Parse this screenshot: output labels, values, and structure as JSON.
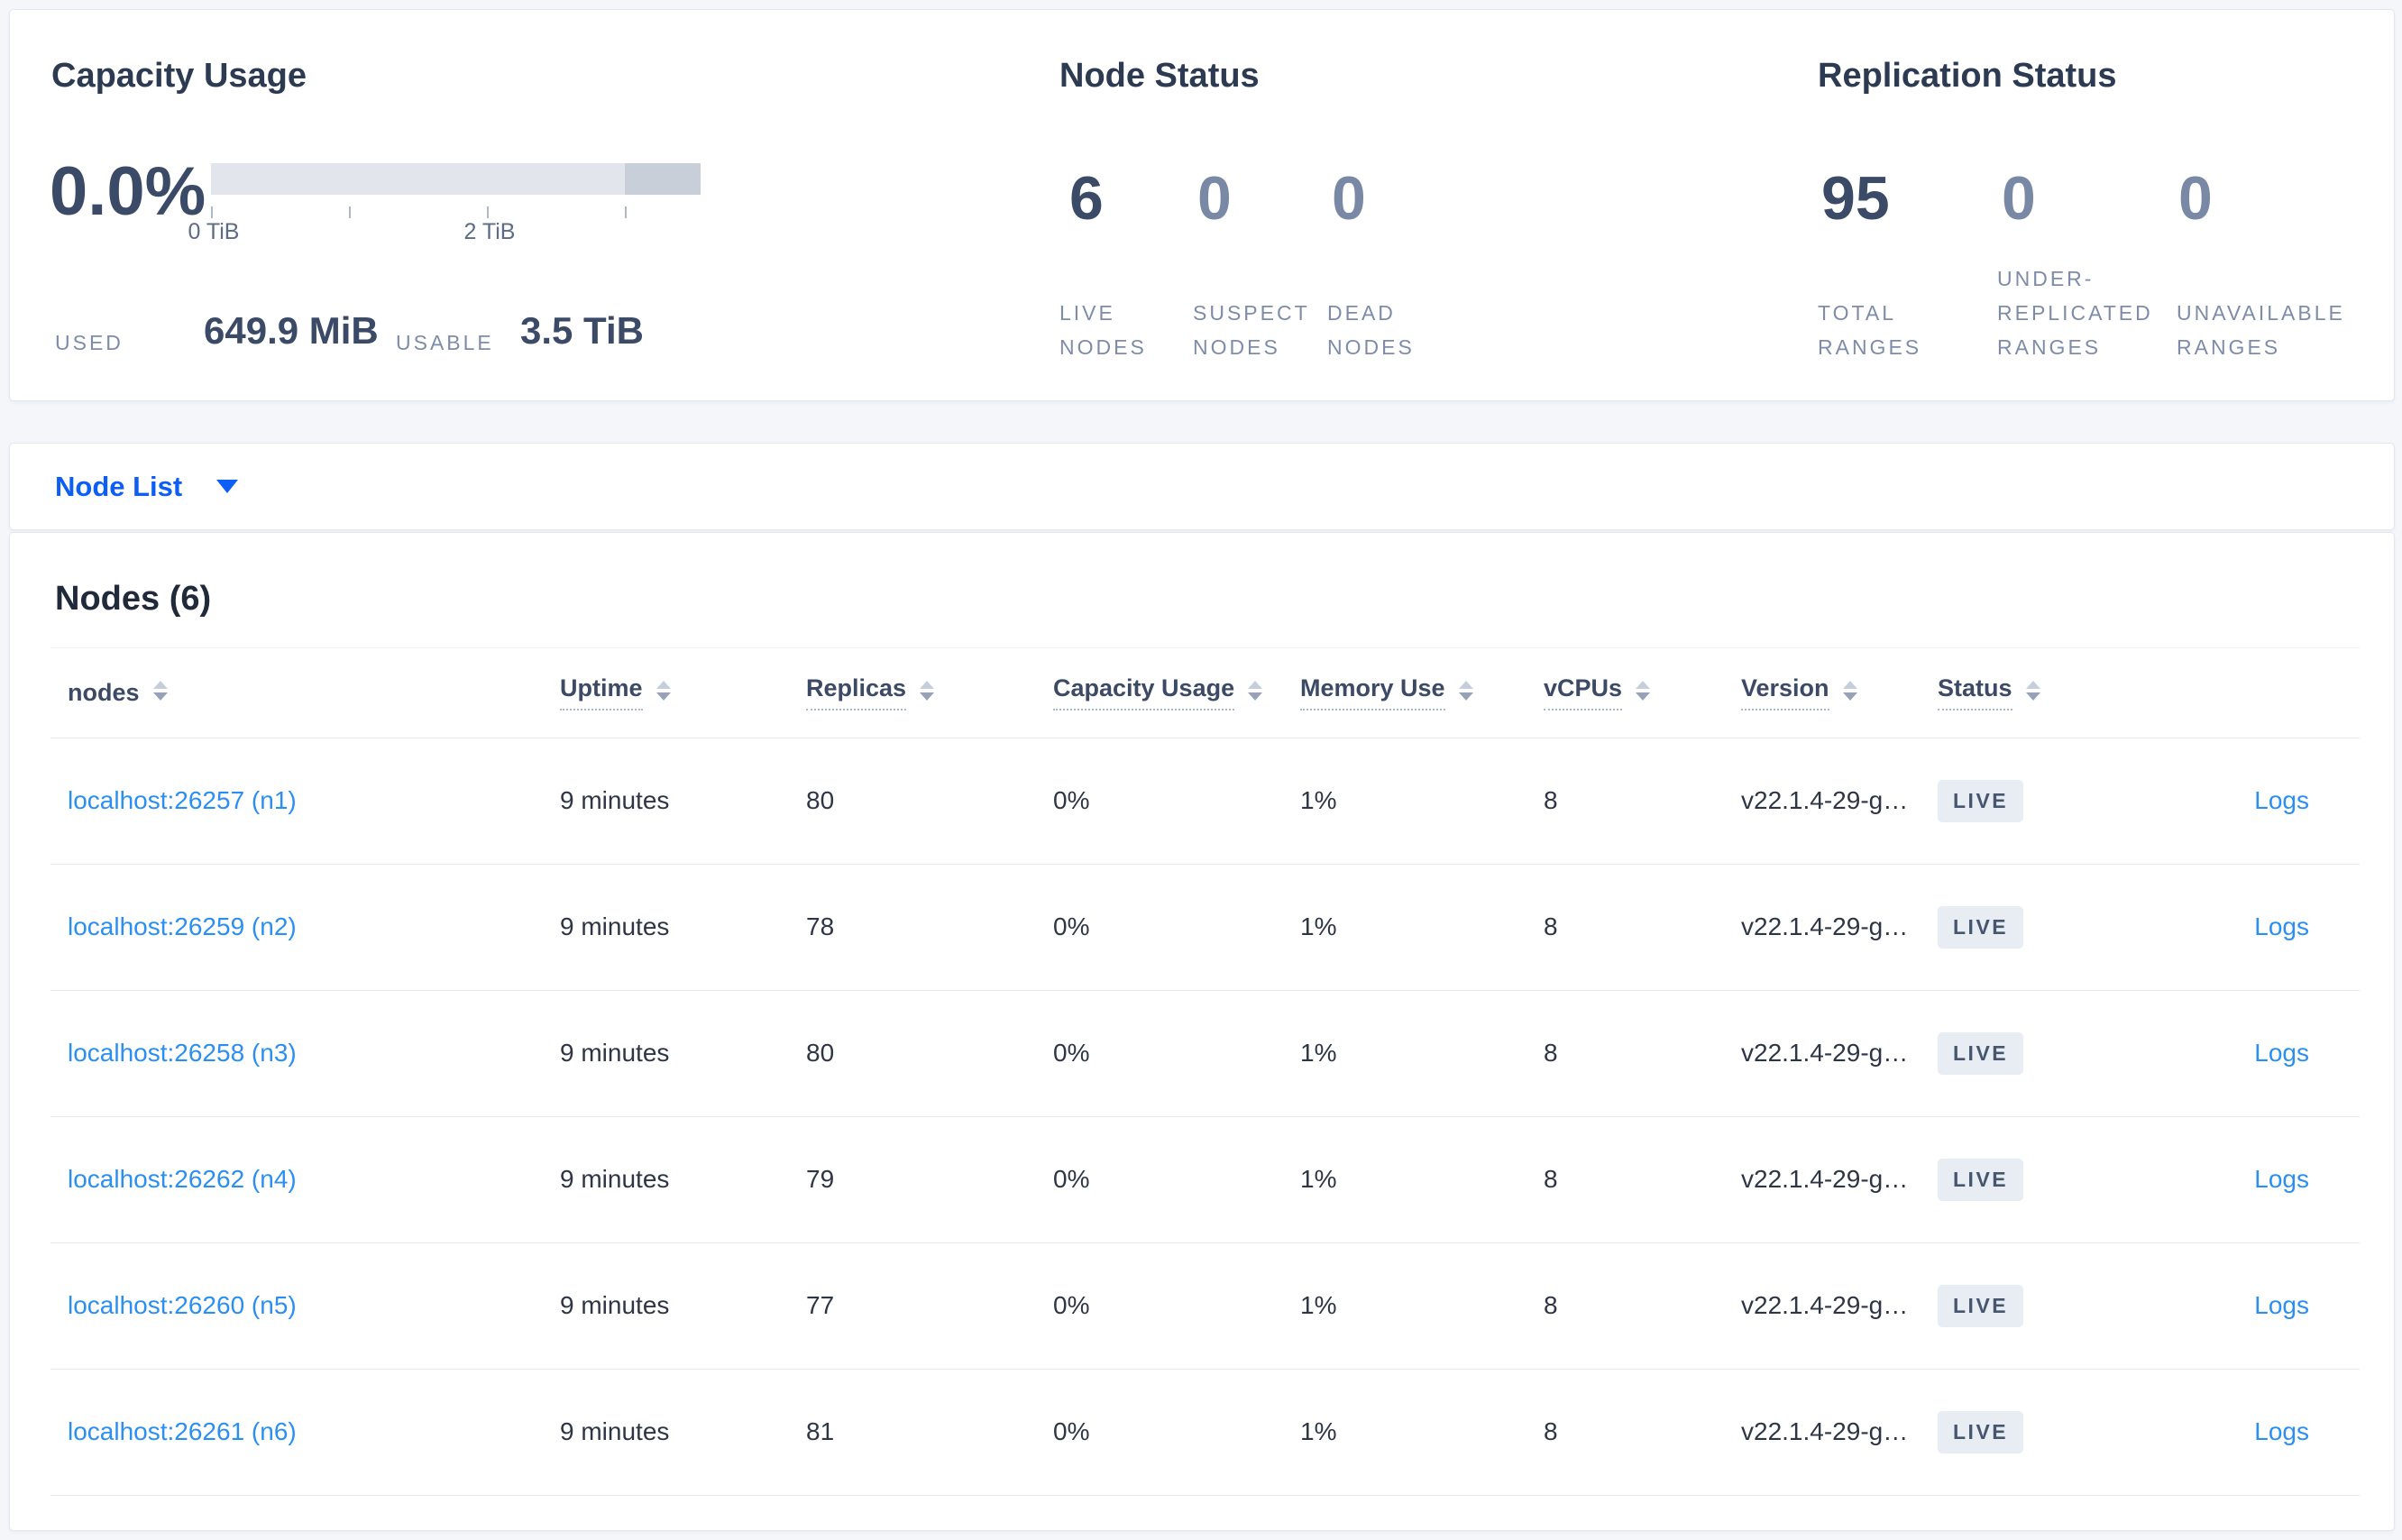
{
  "summary": {
    "capacity": {
      "title": "Capacity Usage",
      "percent": "0.0%",
      "tick_labels": [
        "0 TiB",
        "2 TiB"
      ],
      "used_label": "USED",
      "used_value": "649.9 MiB",
      "usable_label": "USABLE",
      "usable_value": "3.5 TiB"
    },
    "node_status": {
      "title": "Node Status",
      "metrics": [
        {
          "value": "6",
          "lines": [
            "LIVE",
            "NODES"
          ]
        },
        {
          "value": "0",
          "lines": [
            "SUSPECT",
            "NODES"
          ]
        },
        {
          "value": "0",
          "lines": [
            "DEAD",
            "NODES"
          ]
        }
      ]
    },
    "replication": {
      "title": "Replication Status",
      "metrics": [
        {
          "value": "95",
          "lines": [
            "TOTAL",
            "RANGES"
          ]
        },
        {
          "value": "0",
          "lines": [
            "UNDER-",
            "REPLICATED",
            "RANGES"
          ]
        },
        {
          "value": "0",
          "lines": [
            "UNAVAILABLE",
            "RANGES"
          ]
        }
      ]
    }
  },
  "node_list": {
    "label": "Node List"
  },
  "nodes": {
    "heading": "Nodes (6)",
    "columns": [
      {
        "label": "nodes"
      },
      {
        "label": "Uptime"
      },
      {
        "label": "Replicas"
      },
      {
        "label": "Capacity Usage"
      },
      {
        "label": "Memory Use"
      },
      {
        "label": "vCPUs"
      },
      {
        "label": "Version"
      },
      {
        "label": "Status"
      }
    ],
    "rows": [
      {
        "address": "localhost:26257 (n1)",
        "uptime": "9 minutes",
        "replicas": "80",
        "capacity": "0%",
        "memory": "1%",
        "vcpus": "8",
        "version": "v22.1.4-29-g…",
        "status": "LIVE",
        "logs": "Logs"
      },
      {
        "address": "localhost:26259 (n2)",
        "uptime": "9 minutes",
        "replicas": "78",
        "capacity": "0%",
        "memory": "1%",
        "vcpus": "8",
        "version": "v22.1.4-29-g…",
        "status": "LIVE",
        "logs": "Logs"
      },
      {
        "address": "localhost:26258 (n3)",
        "uptime": "9 minutes",
        "replicas": "80",
        "capacity": "0%",
        "memory": "1%",
        "vcpus": "8",
        "version": "v22.1.4-29-g…",
        "status": "LIVE",
        "logs": "Logs"
      },
      {
        "address": "localhost:26262 (n4)",
        "uptime": "9 minutes",
        "replicas": "79",
        "capacity": "0%",
        "memory": "1%",
        "vcpus": "8",
        "version": "v22.1.4-29-g…",
        "status": "LIVE",
        "logs": "Logs"
      },
      {
        "address": "localhost:26260 (n5)",
        "uptime": "9 minutes",
        "replicas": "77",
        "capacity": "0%",
        "memory": "1%",
        "vcpus": "8",
        "version": "v22.1.4-29-g…",
        "status": "LIVE",
        "logs": "Logs"
      },
      {
        "address": "localhost:26261 (n6)",
        "uptime": "9 minutes",
        "replicas": "81",
        "capacity": "0%",
        "memory": "1%",
        "vcpus": "8",
        "version": "v22.1.4-29-g…",
        "status": "LIVE",
        "logs": "Logs"
      }
    ]
  },
  "colors": {
    "accent_blue": "#0d5ef5",
    "link_blue": "#2b8ff2",
    "badge_bg": "#e8edf4",
    "bar_track": "#e2e5ec",
    "bar_reserved": "#c9cfd9"
  }
}
